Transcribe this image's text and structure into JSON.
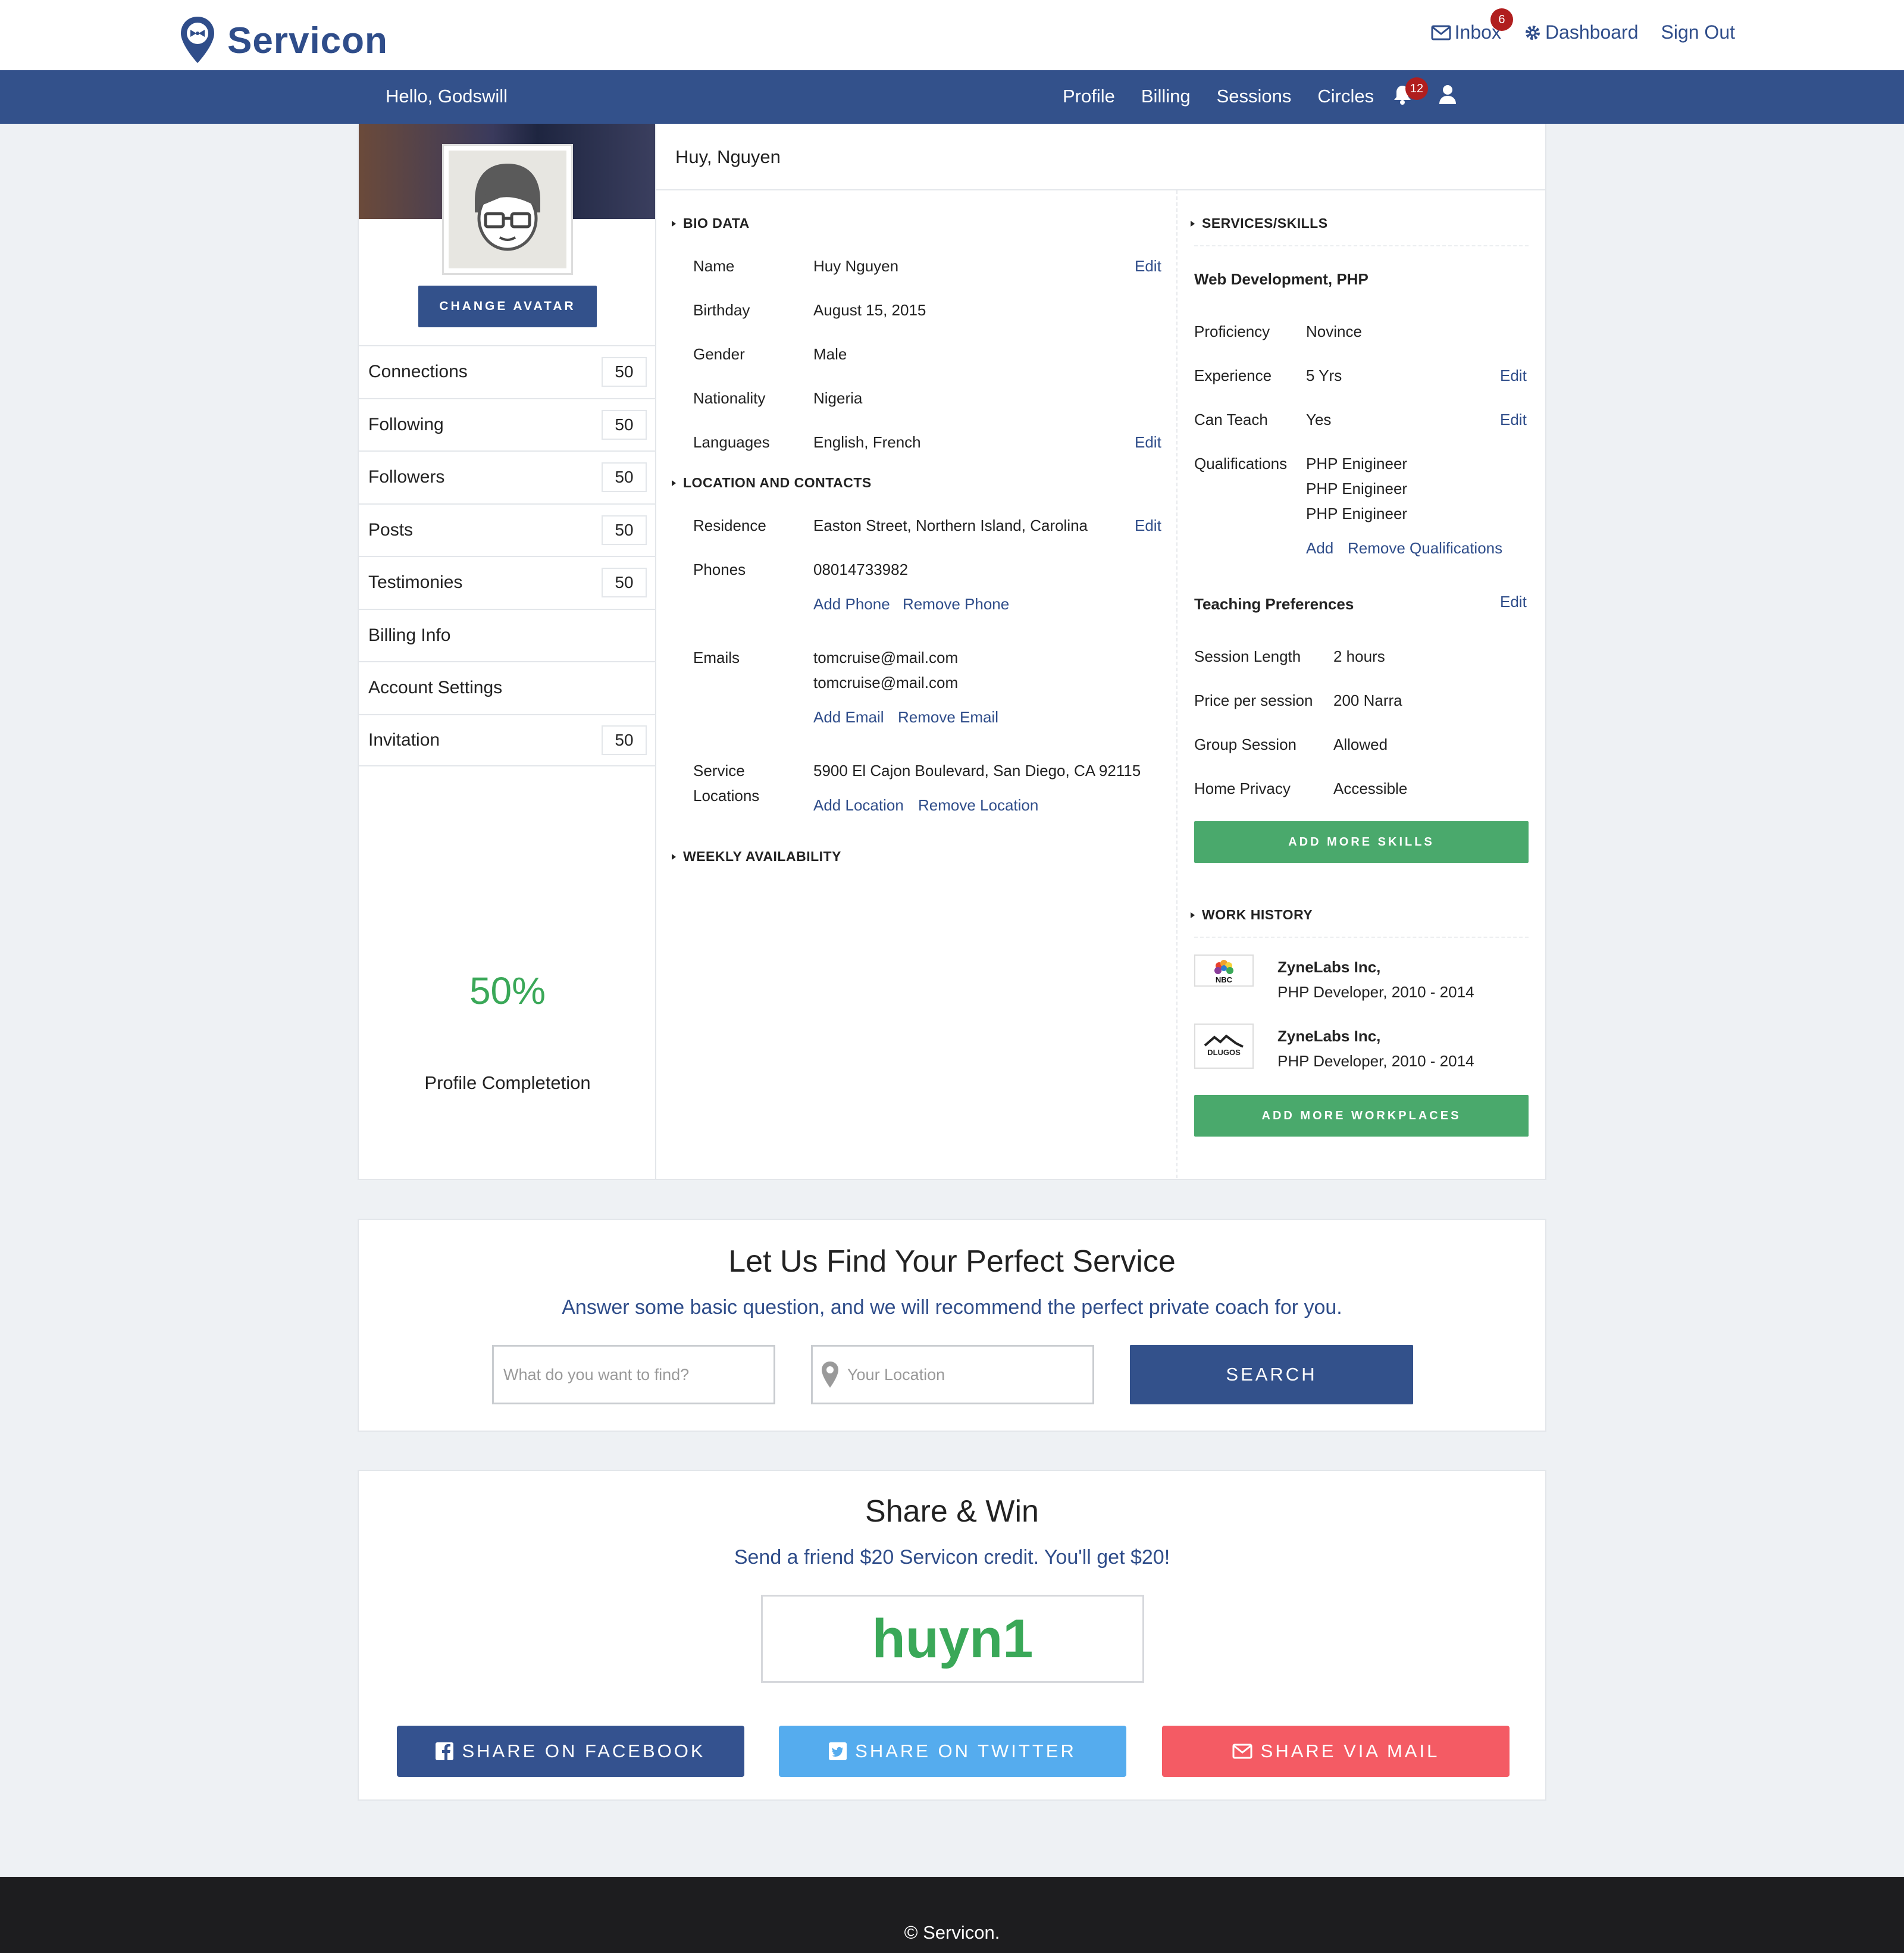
{
  "brand": {
    "name": "Servicon"
  },
  "topbar": {
    "inbox": "Inbox",
    "inbox_badge": "6",
    "dashboard": "Dashboard",
    "sign_out": "Sign Out"
  },
  "nav": {
    "greeting": "Hello, Godswill",
    "links": [
      "Profile",
      "Billing",
      "Sessions",
      "Circles"
    ],
    "notification_badge": "12"
  },
  "sidebar": {
    "change_avatar": "CHANGE AVATAR",
    "items": [
      {
        "label": "Connections",
        "count": "50"
      },
      {
        "label": "Following",
        "count": "50"
      },
      {
        "label": "Followers",
        "count": "50"
      },
      {
        "label": "Posts",
        "count": "50"
      },
      {
        "label": "Testimonies",
        "count": "50"
      },
      {
        "label": "Billing Info",
        "count": ""
      },
      {
        "label": "Account Settings",
        "count": ""
      },
      {
        "label": "Invitation",
        "count": "50"
      }
    ],
    "completion": "50%",
    "completion_label": "Profile Completetion"
  },
  "profile": {
    "heading": "Huy, Nguyen",
    "bio": {
      "title": "BIO DATA",
      "rows": [
        {
          "label": "Name",
          "value": "Huy Nguyen",
          "edit": "Edit"
        },
        {
          "label": "Birthday",
          "value": "August 15, 2015"
        },
        {
          "label": "Gender",
          "value": "Male"
        },
        {
          "label": "Nationality",
          "value": "Nigeria"
        },
        {
          "label": "Languages",
          "value": "English, French",
          "edit": "Edit"
        }
      ]
    },
    "location": {
      "title": "LOCATION AND CONTACTS",
      "residence_label": "Residence",
      "residence": "Easton Street, Northern Island, Carolina",
      "residence_edit": "Edit",
      "phones_label": "Phones",
      "phone": "08014733982",
      "add_phone": "Add Phone",
      "remove_phone": "Remove Phone",
      "emails_label": "Emails",
      "emails": [
        "tomcruise@mail.com",
        "tomcruise@mail.com"
      ],
      "add_email": "Add Email",
      "remove_email": "Remove Email",
      "service_label_1": "Service",
      "service_label_2": "Locations",
      "service_location": "5900 El Cajon Boulevard, San Diego, CA 92115",
      "add_location": "Add Location",
      "remove_location": "Remove Location"
    },
    "weekly": {
      "title": "WEEKLY AVAILABILITY"
    },
    "skills": {
      "title": "SERVICES/SKILLS",
      "skill_name": "Web Development, PHP",
      "rows": [
        {
          "label": "Proficiency",
          "value": "Novince"
        },
        {
          "label": "Experience",
          "value": "5 Yrs",
          "edit": "Edit"
        },
        {
          "label": "Can Teach",
          "value": "Yes",
          "edit": "Edit"
        }
      ],
      "qualifications_label": "Qualifications",
      "qualifications": [
        "PHP Enigineer",
        "PHP Enigineer",
        "PHP Enigineer"
      ],
      "add": "Add",
      "remove_qualifications": "Remove Qualifications",
      "teaching_title": "Teaching Preferences",
      "teaching_edit": "Edit",
      "teaching": [
        {
          "label": "Session Length",
          "value": "2 hours"
        },
        {
          "label": "Price per session",
          "value": "200 Narra"
        },
        {
          "label": "Group Session",
          "value": "Allowed"
        },
        {
          "label": "Home Privacy",
          "value": "Accessible"
        }
      ],
      "add_skills": "ADD MORE SKILLS"
    },
    "work": {
      "title": "WORK HISTORY",
      "items": [
        {
          "logo": "NBC",
          "company": "ZyneLabs Inc,",
          "role": "PHP Developer, 2010 - 2014"
        },
        {
          "logo": "DLUGOS",
          "company": "ZyneLabs Inc,",
          "role": "PHP Developer, 2010 - 2014"
        }
      ],
      "add_workplaces": "ADD MORE WORKPLACES"
    }
  },
  "find": {
    "title": "Let Us Find Your Perfect Service",
    "subtitle": "Answer some basic question, and we will recommend the perfect private coach for you.",
    "what_placeholder": "What do you want to find?",
    "location_placeholder": "Your Location",
    "search": "SEARCH"
  },
  "share": {
    "title": "Share & Win",
    "subtitle": "Send a friend $20 Servicon credit. You'll get $20!",
    "code": "huyn1",
    "facebook": "SHARE ON FACEBOOK",
    "twitter": "SHARE ON TWITTER",
    "mail": "SHARE VIA MAIL"
  },
  "footer": {
    "text": "© Servicon."
  },
  "colors": {
    "brand_blue": "#33518b",
    "green": "#4aa96c",
    "twitter": "#55acee",
    "mail": "#f45b64"
  }
}
